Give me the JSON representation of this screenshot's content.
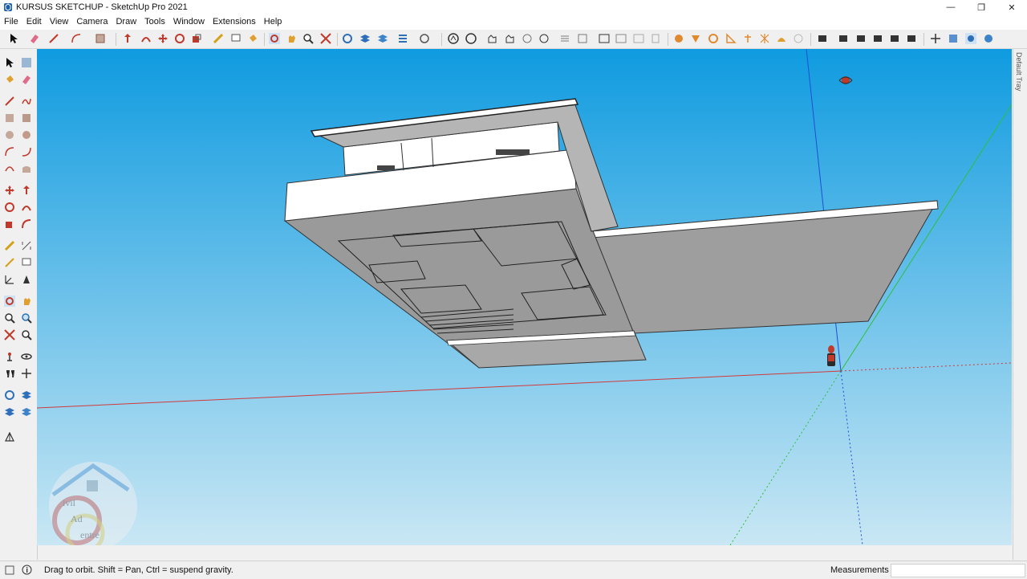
{
  "window": {
    "title": "KURSUS SKETCHUP - SketchUp Pro 2021",
    "minimize": "—",
    "restore": "❐",
    "close": "✕"
  },
  "menu": [
    "File",
    "Edit",
    "View",
    "Camera",
    "Draw",
    "Tools",
    "Window",
    "Extensions",
    "Help"
  ],
  "tray": {
    "label": "Default Tray"
  },
  "status": {
    "hint": "Drag to orbit. Shift = Pan, Ctrl = suspend gravity.",
    "measurements_label": "Measurements",
    "measurements_value": ""
  },
  "watermark": {
    "line1": "ivil",
    "line2": "Ad",
    "line3": "entre"
  },
  "colors": {
    "sky_top": "#0f9be0",
    "sky_bottom": "#c9e7f4",
    "ground_strip": "#c7d2d7",
    "red_axis": "#d13a3a",
    "green_axis": "#2fbf3a",
    "blue_axis": "#1d4fd6",
    "model_gray": "#9a9a9a",
    "model_white": "#ffffff"
  },
  "icons": {
    "top_toolbar": [
      "select-icon",
      "eraser-icon",
      "line-icon",
      "arc-icon",
      "rectangle-icon",
      "push-pull-icon",
      "follow-me-icon",
      "move-icon",
      "rotate-icon",
      "scale-icon",
      "tape-measure-icon",
      "text-icon",
      "paint-bucket-icon",
      "orbit-icon",
      "pan-icon",
      "zoom-icon",
      "zoom-extents-icon",
      "iso-view-icon",
      "top-view-icon",
      "front-view-icon",
      "section-plane-icon",
      "shadows-icon",
      "sandbox-icon",
      "style-icon",
      "warehouse-icon",
      "extension-icon",
      "layout-icon"
    ],
    "left_toolbar": [
      "select-icon",
      "component-icon",
      "paint-bucket-icon",
      "eraser-icon",
      "line-icon",
      "freehand-icon",
      "rectangle-icon",
      "rotated-rectangle-icon",
      "circle-icon",
      "polygon-icon",
      "arc-icon",
      "pie-icon",
      "two-point-arc-icon",
      "three-point-arc-icon",
      "move-icon",
      "push-pull-icon",
      "rotate-icon",
      "follow-me-icon",
      "scale-icon",
      "offset-icon",
      "tape-measure-icon",
      "dimension-icon",
      "protractor-icon",
      "text-icon",
      "axes-icon",
      "3d-text-icon",
      "orbit-icon",
      "pan-icon",
      "zoom-icon",
      "zoom-window-icon",
      "zoom-extents-icon",
      "previous-view-icon",
      "position-camera-icon",
      "look-around-icon",
      "walk-icon",
      "section-plane-icon",
      "display-section-icon",
      "section-fill-icon",
      "sandbox-icon"
    ]
  }
}
